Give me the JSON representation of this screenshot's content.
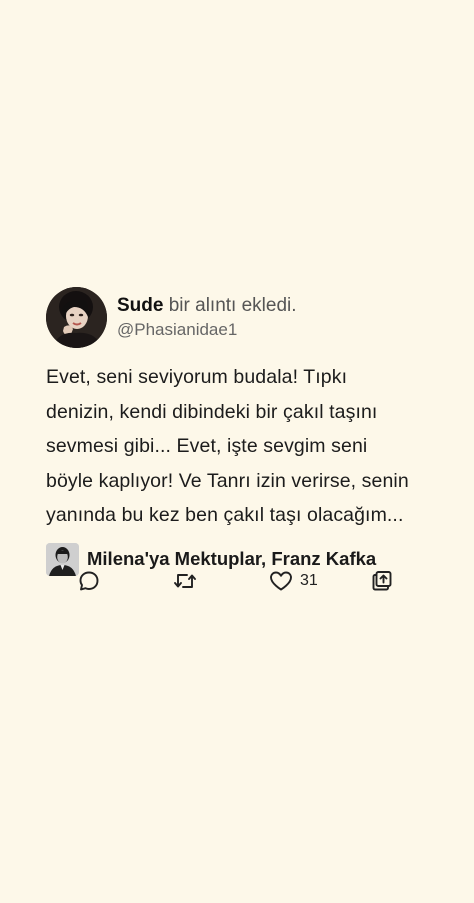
{
  "post": {
    "user_name": "Sude",
    "action_text": "bir alıntı ekledi.",
    "handle": "@Phasianidae1",
    "quote_lines": [
      "Evet, seni seviyorum budala! Tıpkı",
      "denizin, kendi dibindeki bir çakıl taşını",
      "sevmesi gibi... Evet, işte sevgim seni",
      "böyle kaplıyor! Ve Tanrı izin verirse, senin",
      "yanında bu kez ben çakıl taşı olacağım..."
    ],
    "book_title": "Milena'ya Mektuplar, Franz Kafka"
  },
  "actions": {
    "reply_icon": "comment-icon",
    "repost_icon": "repost-icon",
    "like_icon": "heart-icon",
    "like_count": "31",
    "share_icon": "share-icon"
  },
  "colors": {
    "background": "#fdf8e9",
    "text": "#1a1a1a",
    "muted": "#666666"
  }
}
